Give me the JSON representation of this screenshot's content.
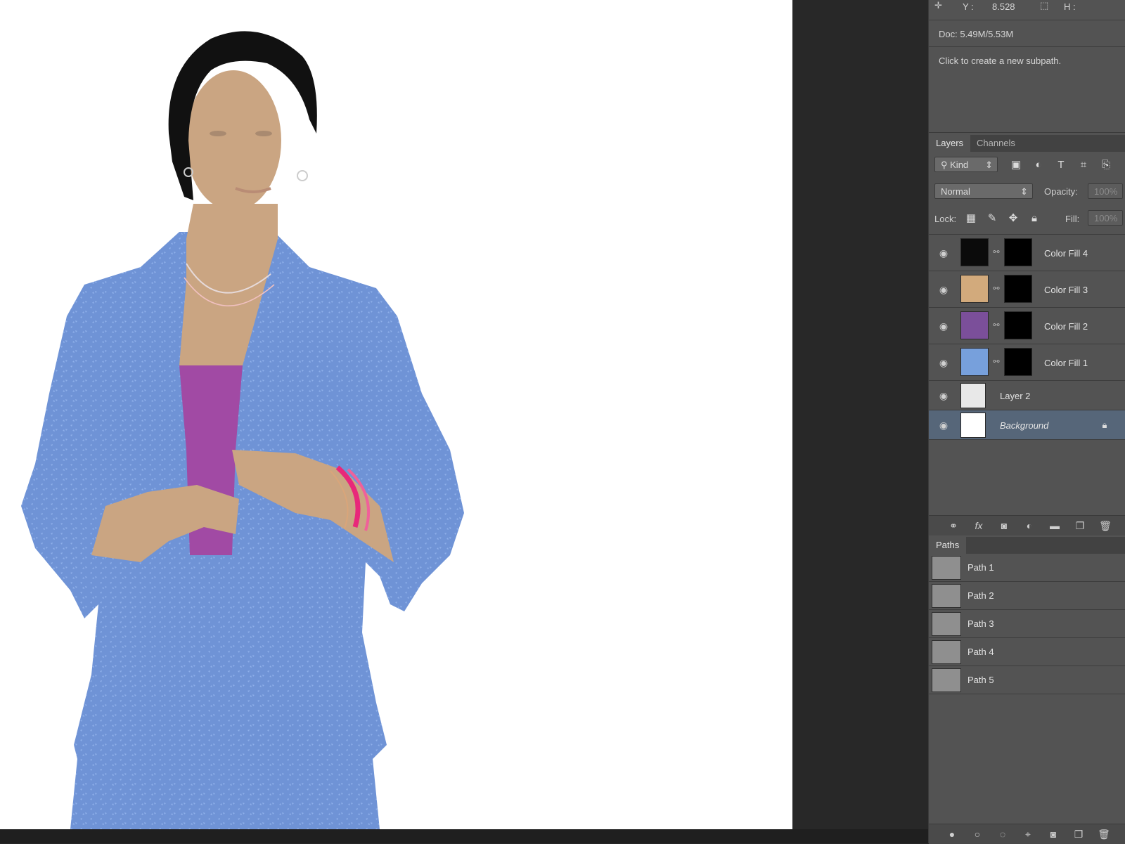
{
  "info": {
    "y_label": "Y :",
    "y_value": "8.528",
    "h_label": "H :",
    "doc_size": "Doc: 5.49M/5.53M",
    "hint": "Click to create a new subpath."
  },
  "layers_panel": {
    "tabs": [
      "Layers",
      "Channels"
    ],
    "filter": "Kind",
    "blend_mode": "Normal",
    "opacity_label": "Opacity:",
    "opacity_value": "100%",
    "lock_label": "Lock:",
    "fill_label": "Fill:",
    "fill_value": "100%",
    "layers": [
      {
        "name": "Color Fill 4",
        "color": "#0b0b0b"
      },
      {
        "name": "Color Fill 3",
        "color": "#d2aa7c"
      },
      {
        "name": "Color Fill 2",
        "color": "#7b4f9a"
      },
      {
        "name": "Color Fill 1",
        "color": "#77a0dc"
      },
      {
        "name": "Layer 2"
      },
      {
        "name": "Background"
      }
    ]
  },
  "paths_panel": {
    "title": "Paths",
    "paths": [
      "Path 1",
      "Path 2",
      "Path 3",
      "Path 4",
      "Path 5"
    ]
  },
  "colors": {
    "jacket": "#6f93d6",
    "top": "#a14aa4",
    "skin": "#caa582",
    "hair": "#111111",
    "bangles": "#e8287a",
    "selected_layer": "#566679"
  }
}
